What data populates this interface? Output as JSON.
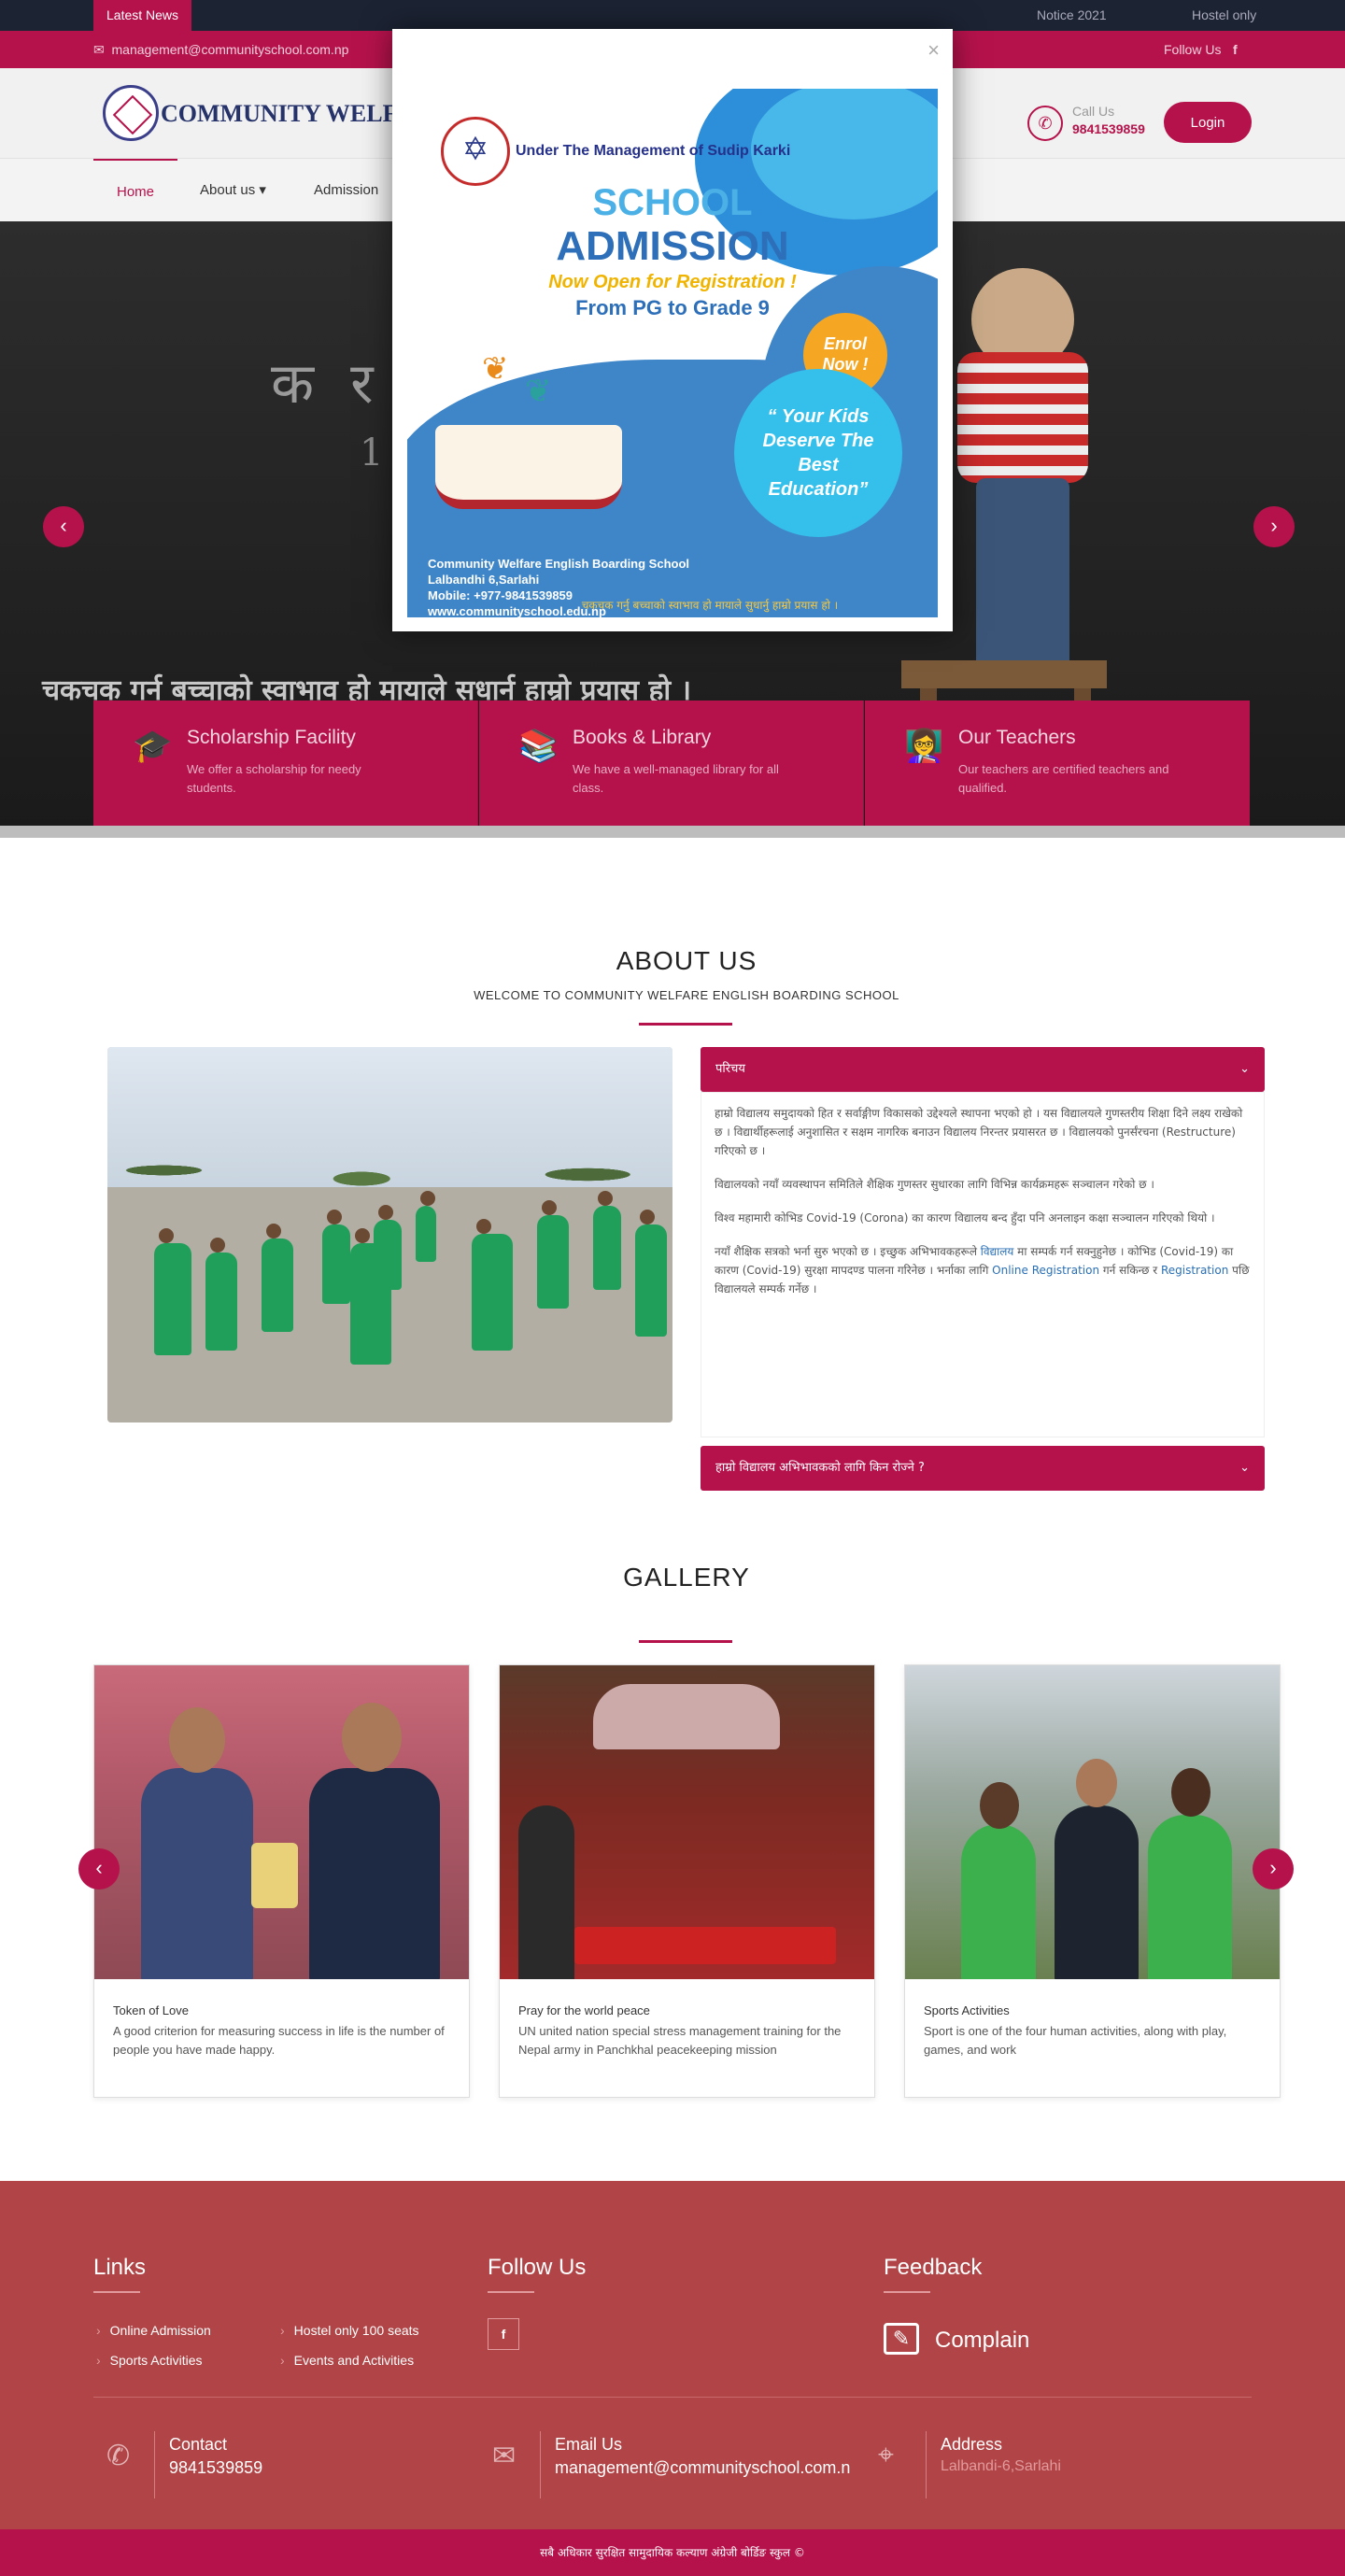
{
  "topbar": {
    "latest_news": "Latest News",
    "news_items": [
      "Notice 2021",
      "Hostel only"
    ]
  },
  "contactbar": {
    "email": "management@communityschool.com.np",
    "follow_us": "Follow Us",
    "fb": "f"
  },
  "header": {
    "logo_text": "COMMUNITY WELFARE ENGLI",
    "call_label": "Call Us",
    "call_number": "9841539859",
    "login": "Login"
  },
  "nav": {
    "items": [
      "Home",
      "About us ▾",
      "Admission"
    ]
  },
  "hero": {
    "chalk_text": "क र",
    "chalk_num": "1",
    "caption": "चकचक गर्न बच्चाको स्वाभाव हो मायाले सधार्न हाम्रो प्रयास हो ।",
    "prev": "‹",
    "next": "›"
  },
  "features": [
    {
      "icon": "graduation-cap-icon",
      "title": "Scholarship Facility",
      "desc": "We offer a scholarship for needy students."
    },
    {
      "icon": "books-icon",
      "title": "Books & Library",
      "desc": "We have a well-managed library for all class."
    },
    {
      "icon": "teacher-icon",
      "title": "Our Teachers",
      "desc": "Our teachers are certified teachers and qualified."
    }
  ],
  "popup": {
    "close": "×",
    "management": "Under The Management of Sudip Karki",
    "school": "SCHOOL",
    "admission": "ADMISSION",
    "open": "Now Open for Registration !",
    "grade": "From PG to Grade 9",
    "enrol_line1": "Enrol",
    "enrol_line2": "Now !",
    "quote": "“ Your Kids Deserve The Best Education”",
    "info_name": "Community Welfare English Boarding School",
    "info_addr": "Lalbandhi 6,Sarlahi",
    "info_mobile": "Mobile: +977-9841539859",
    "info_web": "www.communityschool.edu.np",
    "tagline": "चकचक गर्नु बच्चाको स्वाभाव हो मायाले सुधार्नु हाम्रो प्रयास हो ।"
  },
  "about": {
    "title": "ABOUT US",
    "subtitle": "WELCOME TO COMMUNITY WELFARE ENGLISH BOARDING SCHOOL",
    "acc1_title": "परिचय",
    "acc1_p1": "हाम्रो विद्यालय समुदायको हित र सर्वाङ्गीण विकासको उद्देश्यले स्थापना भएको हो । यस विद्यालयले गुणस्तरीय शिक्षा दिने लक्ष्य राखेको छ । विद्यार्थीहरूलाई अनुशासित र सक्षम नागरिक बनाउन विद्यालय निरन्तर प्रयासरत छ । विद्यालयको पुनर्संरचना (Restructure) गरिएको छ ।",
    "acc1_p2": "विद्यालयको नयाँ व्यवस्थापन समितिले शैक्षिक गुणस्तर सुधारका लागि विभिन्न कार्यक्रमहरू सञ्चालन गरेको छ ।",
    "acc1_p3": "विश्व महामारी कोभिड Covid-19 (Corona) का कारण विद्यालय बन्द हुँदा पनि अनलाइन कक्षा सञ्चालन गरिएको थियो ।",
    "acc1_p4a": "नयाँ शैक्षिक सत्रको भर्ना सुरु भएको छ । इच्छुक अभिभावकहरूले",
    "acc1_p4link1": "विद्यालय",
    "acc1_p4b": "मा सम्पर्क गर्न सक्नुहुनेछ । कोभिड (Covid-19) का कारण (Covid-19) सुरक्षा मापदण्ड पालना गरिनेछ । भर्नाका लागि",
    "acc1_p4link2": "Online Registration",
    "acc1_p4c": "गर्न सकिन्छ र",
    "acc1_p4link3": "Registration",
    "acc1_p4d": "पछि विद्यालयले सम्पर्क गर्नेछ ।",
    "acc2_title": "हाम्रो विद्यालय अभिभावकको लागि किन रोज्ने ?",
    "chevron": "⌄"
  },
  "gallery": {
    "title": "GALLERY",
    "prev": "‹",
    "next": "›",
    "items": [
      {
        "title": "Token of Love",
        "desc": "A good criterion for measuring success in life is the number of people you have made happy."
      },
      {
        "title": "Pray for the world peace",
        "desc": "UN united nation special stress management training for the Nepal army in Panchkhal peacekeeping mission"
      },
      {
        "title": "Sports Activities",
        "desc": "Sport is one of the four human activities, along with play, games, and work"
      }
    ]
  },
  "footer": {
    "links_title": "Links",
    "links": [
      "Online Admission",
      "Hostel only 100 seats",
      "Sports Activities",
      "Events and Activities"
    ],
    "follow_title": "Follow Us",
    "fb": "f",
    "feedback_title": "Feedback",
    "complain": "Complain",
    "contact_label": "Contact",
    "contact_value": "9841539859",
    "email_label": "Email Us",
    "email_value": "management@communityschool.com.n",
    "address_label": "Address",
    "address_value": "Lalbandi-6,Sarlahi",
    "copyright": "सबै अधिकार सुरक्षित सामुदायिक कल्याण अंग्रेजी बोर्डिङ स्कुल ©"
  }
}
